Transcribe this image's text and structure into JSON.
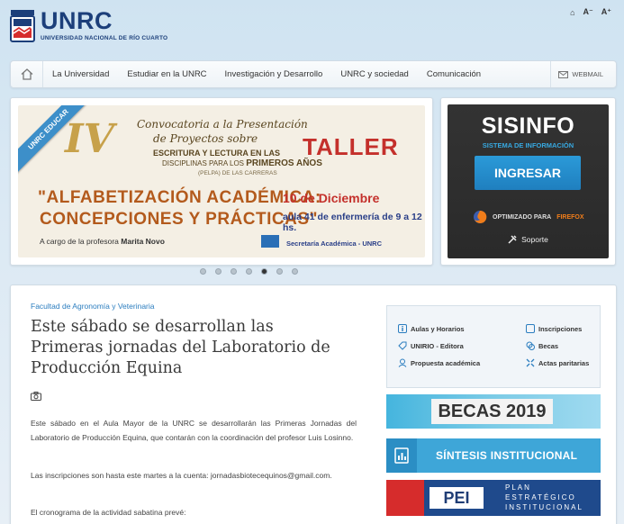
{
  "header": {
    "brand_name": "UNRC",
    "brand_sub": "UNIVERSIDAD NACIONAL DE RÍO CUARTO",
    "tools": {
      "home": "⌂",
      "font_small": "A⁻",
      "font_large": "A⁺"
    }
  },
  "nav": {
    "items": [
      "La Universidad",
      "Estudiar en la UNRC",
      "Investigación y Desarrollo",
      "UNRC y sociedad",
      "Comunicación"
    ],
    "webmail": "WEBMAIL"
  },
  "slider": {
    "ribbon": "UNRC EDUCAR",
    "roman": "IV",
    "line1": "Convocatoria a la Presentación",
    "line2": "de Proyectos sobre",
    "line3": "ESCRITURA Y LECTURA EN LAS",
    "line4_prefix": "DISCIPLINAS PARA LOS",
    "line4_bold": "PRIMEROS AÑOS",
    "line5": "(PELPA) DE LAS CARRERAS",
    "taller": "TALLER",
    "title1": "\"ALFABETIZACIÓN ACADÉMICA:",
    "title2": "CONCEPCIONES Y PRÁCTICAS\"",
    "date": "10 de Diciembre",
    "place": "aula 41 de enfermería de 9 a 12 hs.",
    "prof_prefix": "A cargo de la profesora",
    "prof_name": "Marita Novo",
    "secretaria": "Secretaría Académica - UNRC",
    "dots": 7,
    "active_dot": 4
  },
  "sisinfo": {
    "title": "SISINFO",
    "subtitle": "SISTEMA DE INFORMACIÓN",
    "button": "INGRESAR",
    "optimized_prefix": "OPTIMIZADO PARA",
    "optimized_browser": "FIREFOX",
    "support": "Soporte"
  },
  "article": {
    "category": "Facultad de Agronomía y Veterinaria",
    "title": "Este sábado se desarrollan las Primeras jornadas del Laboratorio de Producción Equina",
    "p1": "Este sábado en el Aula Mayor de la UNRC se desarrollarán las Primeras Jornadas del Laboratorio de Producción Equina, que contarán con la coordinación del profesor Luis Losinno.",
    "p2": "Las inscripciones son hasta este martes a la cuenta: jornadasbiotecequinos@gmail.com.",
    "p3": "El cronograma de la actividad sabatina prevé:"
  },
  "quick_links": [
    "Aulas y Horarios",
    "Inscripciones",
    "UNIRIO - Editora",
    "Becas",
    "Propuesta académica",
    "Actas paritarias"
  ],
  "banners": {
    "becas": "BECAS 2019",
    "sintesis": "SÍNTESIS INSTITUCIONAL",
    "pei": "PEI",
    "plan": [
      "PLAN",
      "ESTRATÉGICO",
      "INSTITUCIONAL"
    ]
  },
  "colors": {
    "brand": "#1c3f7a",
    "accent": "#2b9ad8",
    "link": "#2b7dbf"
  }
}
